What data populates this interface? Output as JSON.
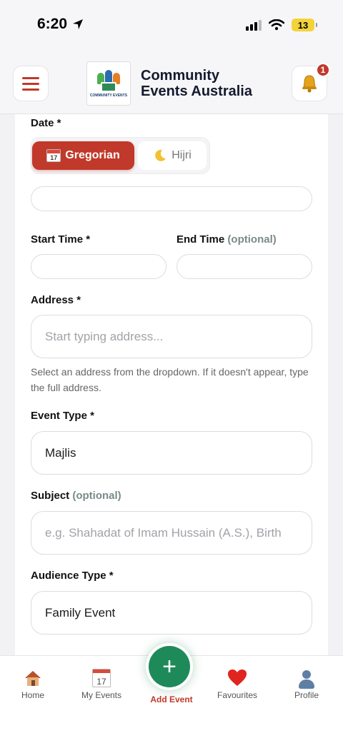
{
  "status_bar": {
    "time": "6:20",
    "battery": "13"
  },
  "header": {
    "brand_line1": "Community",
    "brand_line2": "Events Australia",
    "logo_text": "COMMUNITY EVENTS",
    "notification_count": "1"
  },
  "form": {
    "date": {
      "label": "Date *",
      "gregorian_label": "Gregorian",
      "hijri_label": "Hijri",
      "gregorian_icon_text": "17",
      "value": ""
    },
    "start_time": {
      "label": "Start Time *",
      "value": ""
    },
    "end_time": {
      "label": "End Time",
      "optional": "(optional)",
      "value": ""
    },
    "address": {
      "label": "Address *",
      "placeholder": "Start typing address...",
      "helper": "Select an address from the dropdown. If it doesn't appear, type the full address."
    },
    "event_type": {
      "label": "Event Type *",
      "value": "Majlis"
    },
    "subject": {
      "label": "Subject",
      "optional": "(optional)",
      "placeholder": "e.g. Shahadat of Imam Hussain (A.S.), Birth"
    },
    "audience_type": {
      "label": "Audience Type *",
      "value": "Family Event"
    }
  },
  "bottom_nav": {
    "items": [
      {
        "label": "Home",
        "icon": "house-icon"
      },
      {
        "label": "My Events",
        "icon": "calendar-icon",
        "icon_text": "17"
      },
      {
        "label": "Add Event",
        "icon": "plus-icon"
      },
      {
        "label": "Favourites",
        "icon": "heart-icon"
      },
      {
        "label": "Profile",
        "icon": "person-icon"
      }
    ]
  },
  "colors": {
    "accent_red": "#c0392b",
    "accent_green": "#1e8a5a"
  }
}
